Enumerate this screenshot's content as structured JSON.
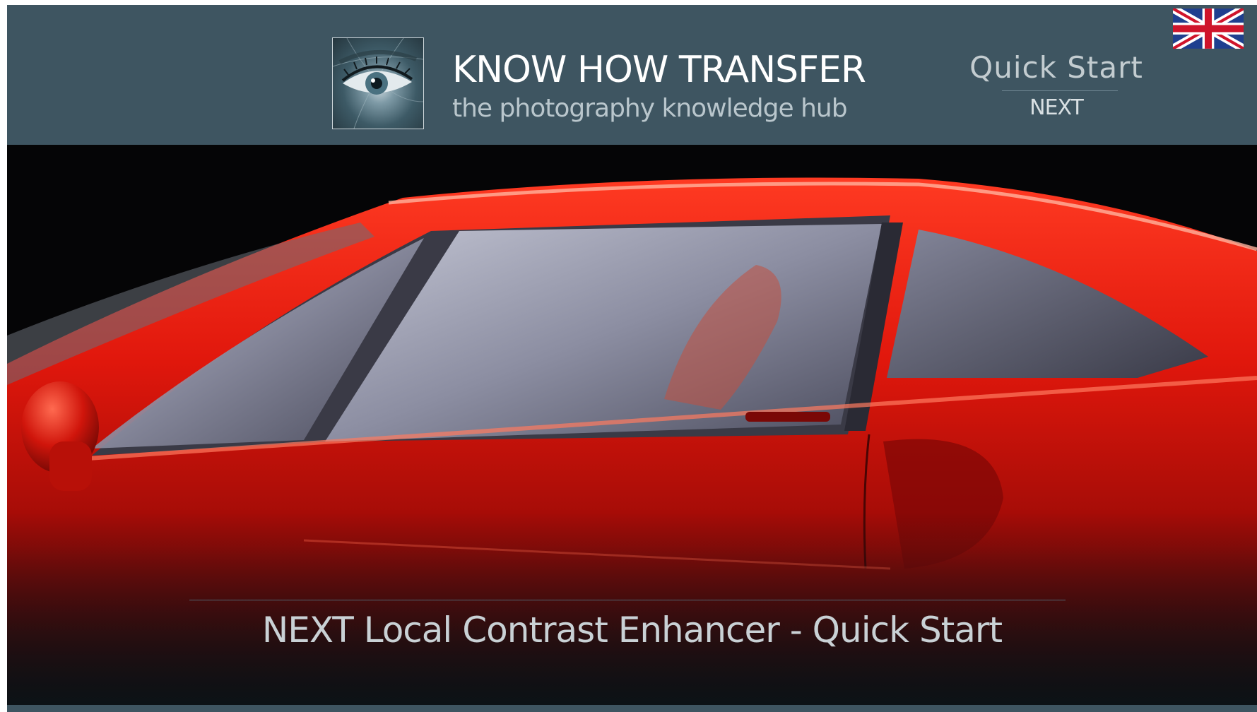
{
  "header": {
    "brand_title": "KNOW HOW TRANSFER",
    "brand_subtitle": "the photography knowledge hub",
    "quick_start_label": "Quick Start",
    "next_label": "NEXT",
    "language_icon": "uk-flag-icon"
  },
  "hero": {
    "caption": "NEXT Local Contrast Enhancer -  Quick Start"
  },
  "colors": {
    "header_bg": "#3e5561",
    "car_red": "#d8160d",
    "caption_text": "#c9d1d5"
  }
}
